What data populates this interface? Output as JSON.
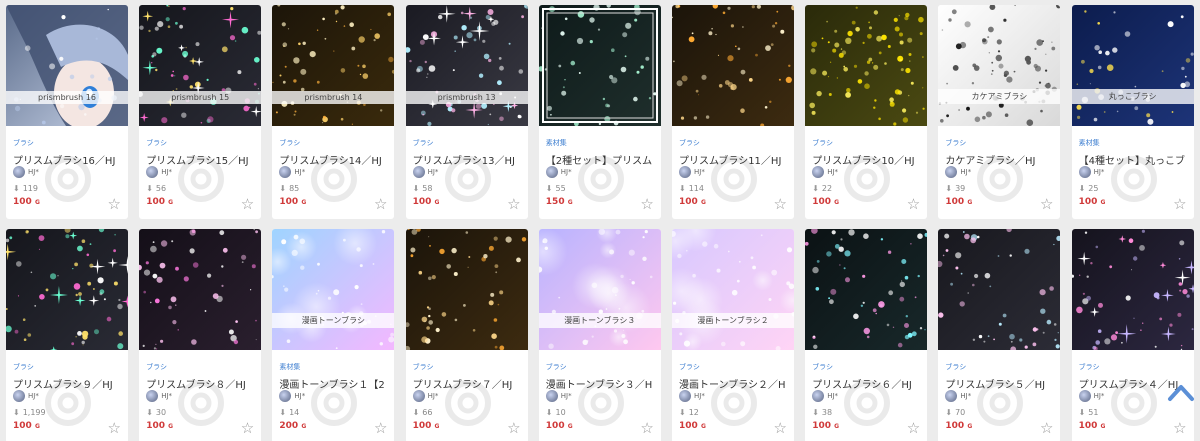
{
  "colors": {
    "price": "#d03a3a",
    "category": "#3f7fd0",
    "scroll_top": "#5b8fd6"
  },
  "icons": {
    "download": "download-icon",
    "favorite": "star-outline-icon",
    "scroll_top": "chevron-up-icon"
  },
  "products": [
    {
      "category": "ブラシ",
      "title": "プリスムブラシ16／HJ",
      "author": "HJ*",
      "downloads": "119",
      "price": "100",
      "currency": "G",
      "theme": "anime",
      "overlay": "prismbrush 16"
    },
    {
      "category": "ブラシ",
      "title": "プリスムブラシ15／HJ",
      "author": "HJ*",
      "downloads": "56",
      "price": "100",
      "currency": "G",
      "theme": "sparkle",
      "overlay": "prismbrush 15"
    },
    {
      "category": "ブラシ",
      "title": "プリスムブラシ14／HJ",
      "author": "HJ*",
      "downloads": "85",
      "price": "100",
      "currency": "G",
      "theme": "gold",
      "overlay": "prismbrush 14"
    },
    {
      "category": "ブラシ",
      "title": "プリスムブラシ13／HJ",
      "author": "HJ*",
      "downloads": "58",
      "price": "100",
      "currency": "G",
      "theme": "starsmix",
      "overlay": "prismbrush 13"
    },
    {
      "category": "素材集",
      "title": "【2種セット】プリスム",
      "author": "HJ*",
      "downloads": "55",
      "price": "150",
      "currency": "G",
      "theme": "stack",
      "overlay": ""
    },
    {
      "category": "ブラシ",
      "title": "プリスムブラシ11／HJ",
      "author": "HJ*",
      "downloads": "114",
      "price": "100",
      "currency": "G",
      "theme": "goldbokeh",
      "overlay": ""
    },
    {
      "category": "ブラシ",
      "title": "プリスムブラシ10／HJ",
      "author": "HJ*",
      "downloads": "22",
      "price": "100",
      "currency": "G",
      "theme": "yellowdust",
      "overlay": ""
    },
    {
      "category": "ブラシ",
      "title": "カケアミブラシ／HJ",
      "author": "HJ*",
      "downloads": "39",
      "price": "100",
      "currency": "G",
      "theme": "kakeami",
      "overlay": "カケアミブラシ"
    },
    {
      "category": "素材集",
      "title": "【4種セット】丸っこブ",
      "author": "HJ*",
      "downloads": "25",
      "price": "100",
      "currency": "G",
      "theme": "navystars",
      "overlay": "丸っこブラシ"
    },
    {
      "category": "ブラシ",
      "title": "プリスムブラシ９／HJ",
      "author": "HJ*",
      "downloads": "1,199",
      "price": "100",
      "currency": "G",
      "theme": "sparkle",
      "overlay": ""
    },
    {
      "category": "ブラシ",
      "title": "プリスムブラシ８／HJ",
      "author": "HJ*",
      "downloads": "30",
      "price": "100",
      "currency": "G",
      "theme": "pinkdots",
      "overlay": ""
    },
    {
      "category": "素材集",
      "title": "漫画トーンブラシ１【2",
      "author": "HJ*",
      "downloads": "14",
      "price": "200",
      "currency": "G",
      "theme": "pastel",
      "overlay": "漫画トーンブラシ"
    },
    {
      "category": "ブラシ",
      "title": "プリスムブラシ７／HJ",
      "author": "HJ*",
      "downloads": "66",
      "price": "100",
      "currency": "G",
      "theme": "goldbokeh",
      "overlay": ""
    },
    {
      "category": "ブラシ",
      "title": "漫画トーンブラシ３／H",
      "author": "HJ*",
      "downloads": "10",
      "price": "100",
      "currency": "G",
      "theme": "pastel2",
      "overlay": "漫画トーンブラシ３"
    },
    {
      "category": "ブラシ",
      "title": "漫画トーンブラシ２／H",
      "author": "HJ*",
      "downloads": "12",
      "price": "100",
      "currency": "G",
      "theme": "pastel3",
      "overlay": "漫画トーンブラシ２"
    },
    {
      "category": "ブラシ",
      "title": "プリスムブラシ６／HJ",
      "author": "HJ*",
      "downloads": "38",
      "price": "100",
      "currency": "G",
      "theme": "tealbokeh",
      "overlay": ""
    },
    {
      "category": "ブラシ",
      "title": "プリスムブラシ５／HJ",
      "author": "HJ*",
      "downloads": "70",
      "price": "100",
      "currency": "G",
      "theme": "whitebokeh",
      "overlay": ""
    },
    {
      "category": "ブラシ",
      "title": "プリスムブラシ４／HJ",
      "author": "HJ*",
      "downloads": "51",
      "price": "100",
      "currency": "G",
      "theme": "pinkpetal",
      "overlay": ""
    }
  ],
  "scroll_top_label": "︿"
}
